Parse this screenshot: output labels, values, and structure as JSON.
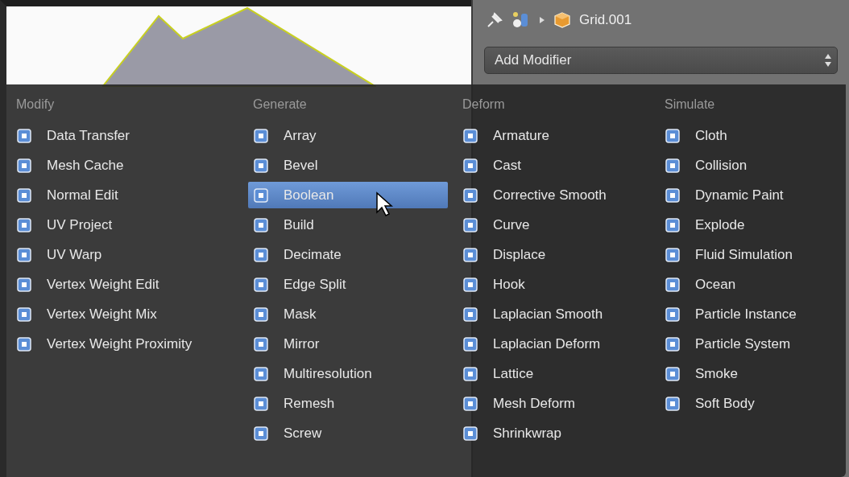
{
  "properties_header": {
    "object_name": "Grid.001"
  },
  "add_modifier": {
    "label": "Add Modifier"
  },
  "menu": {
    "columns": [
      {
        "heading": "Modify",
        "items": [
          {
            "label": "Data Transfer",
            "selected": false
          },
          {
            "label": "Mesh Cache",
            "selected": false
          },
          {
            "label": "Normal Edit",
            "selected": false
          },
          {
            "label": "UV Project",
            "selected": false
          },
          {
            "label": "UV Warp",
            "selected": false
          },
          {
            "label": "Vertex Weight Edit",
            "selected": false
          },
          {
            "label": "Vertex Weight Mix",
            "selected": false
          },
          {
            "label": "Vertex Weight Proximity",
            "selected": false
          }
        ]
      },
      {
        "heading": "Generate",
        "items": [
          {
            "label": "Array",
            "selected": false
          },
          {
            "label": "Bevel",
            "selected": false
          },
          {
            "label": "Boolean",
            "selected": true
          },
          {
            "label": "Build",
            "selected": false
          },
          {
            "label": "Decimate",
            "selected": false
          },
          {
            "label": "Edge Split",
            "selected": false
          },
          {
            "label": "Mask",
            "selected": false
          },
          {
            "label": "Mirror",
            "selected": false
          },
          {
            "label": "Multiresolution",
            "selected": false
          },
          {
            "label": "Remesh",
            "selected": false
          },
          {
            "label": "Screw",
            "selected": false
          }
        ]
      },
      {
        "heading": "Deform",
        "items": [
          {
            "label": "Armature",
            "selected": false
          },
          {
            "label": "Cast",
            "selected": false
          },
          {
            "label": "Corrective Smooth",
            "selected": false
          },
          {
            "label": "Curve",
            "selected": false
          },
          {
            "label": "Displace",
            "selected": false
          },
          {
            "label": "Hook",
            "selected": false
          },
          {
            "label": "Laplacian Smooth",
            "selected": false
          },
          {
            "label": "Laplacian Deform",
            "selected": false
          },
          {
            "label": "Lattice",
            "selected": false
          },
          {
            "label": "Mesh Deform",
            "selected": false
          },
          {
            "label": "Shrinkwrap",
            "selected": false
          }
        ]
      },
      {
        "heading": "Simulate",
        "items": [
          {
            "label": "Cloth",
            "selected": false
          },
          {
            "label": "Collision",
            "selected": false
          },
          {
            "label": "Dynamic Paint",
            "selected": false
          },
          {
            "label": "Explode",
            "selected": false
          },
          {
            "label": "Fluid Simulation",
            "selected": false
          },
          {
            "label": "Ocean",
            "selected": false
          },
          {
            "label": "Particle Instance",
            "selected": false
          },
          {
            "label": "Particle System",
            "selected": false
          },
          {
            "label": "Smoke",
            "selected": false
          },
          {
            "label": "Soft Body",
            "selected": false
          }
        ]
      }
    ]
  }
}
